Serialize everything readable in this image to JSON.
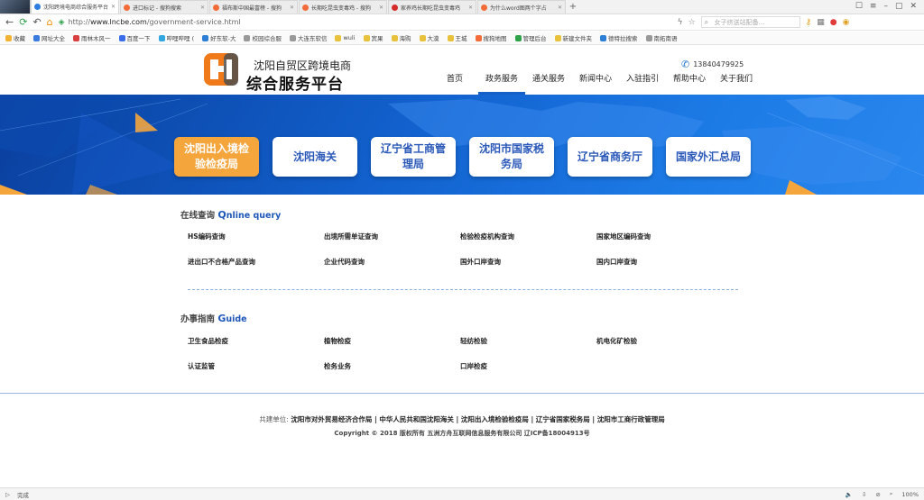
{
  "browser": {
    "tabs": [
      {
        "title": "沈阳跨境电商综合服务平台",
        "color": "#2f7de1",
        "active": true
      },
      {
        "title": "进口标记 - 搜狗搜索",
        "color": "#f26b38",
        "active": false
      },
      {
        "title": "福布斯中国最富榜 - 搜狗",
        "color": "#f26b38",
        "active": false
      },
      {
        "title": "长期吃昆虫变毒鸡 - 搜狗",
        "color": "#f26b38",
        "active": false
      },
      {
        "title": "家养鸡长期吃昆虫变毒鸡",
        "color": "#d62b2b",
        "active": false
      },
      {
        "title": "为什么word图两个字占",
        "color": "#f26b38",
        "active": false
      }
    ],
    "url_prefix": "http://",
    "url_domain": "www.lncbe.com",
    "url_path": "/government-service.html",
    "search_placeholder": "女子挤送站配备…",
    "bookmarks": [
      {
        "label": "收藏",
        "color": "#f2b233"
      },
      {
        "label": "网址大全",
        "color": "#3a7be0"
      },
      {
        "label": "雨林木风一",
        "color": "#d84040"
      },
      {
        "label": "百度一下",
        "color": "#3a6ee8"
      },
      {
        "label": "哔哩哔哩 (",
        "color": "#33a6e0"
      },
      {
        "label": "好东软-大",
        "color": "#2d7fd6"
      },
      {
        "label": "校园综合服",
        "color": "#999999"
      },
      {
        "label": "大连东软信",
        "color": "#999999"
      },
      {
        "label": "wuli",
        "color": "#e8c23c"
      },
      {
        "label": "宾果",
        "color": "#e8c23c"
      },
      {
        "label": "海购",
        "color": "#e8c23c"
      },
      {
        "label": "大漠",
        "color": "#e8c23c"
      },
      {
        "label": "王城",
        "color": "#e8c23c"
      },
      {
        "label": "搜狗地图",
        "color": "#f26b38"
      },
      {
        "label": "管理后台",
        "color": "#2fa24a"
      },
      {
        "label": "新建文件夹",
        "color": "#e8c23c"
      },
      {
        "label": "德特拉搜索",
        "color": "#2d7fd6"
      },
      {
        "label": "南拓南语",
        "color": "#999999"
      }
    ],
    "status_left": "完成",
    "zoom": "100%"
  },
  "header": {
    "brand_line1": "沈阳自贸区跨境电商",
    "brand_line2": "综合服务平台",
    "phone": "13840479925",
    "nav": [
      {
        "label": "首页",
        "active": false
      },
      {
        "label": "政务服务",
        "active": true
      },
      {
        "label": "通关服务",
        "active": false
      },
      {
        "label": "新闻中心",
        "active": false
      },
      {
        "label": "入驻指引",
        "active": false
      },
      {
        "label": "帮助中心",
        "active": false
      },
      {
        "label": "关于我们",
        "active": false
      }
    ]
  },
  "agencies": [
    {
      "label": "沈阳出入境检验检疫局",
      "active": true
    },
    {
      "label": "沈阳海关",
      "active": false
    },
    {
      "label": "辽宁省工商管理局",
      "active": false
    },
    {
      "label": "沈阳市国家税务局",
      "active": false
    },
    {
      "label": "辽宁省商务厅",
      "active": false
    },
    {
      "label": "国家外汇总局",
      "active": false
    }
  ],
  "online_query": {
    "title_cn": "在线查询",
    "title_en_first": "Q",
    "title_en_rest": "nline query",
    "links": [
      "HS编码查询",
      "出境所需单证查询",
      "检验检疫机构查询",
      "国家地区编码查询",
      "进出口不合格产品查询",
      "企业代码查询",
      "国外口岸查询",
      "国内口岸查询"
    ]
  },
  "guide": {
    "title_cn": "办事指南",
    "title_en_first": "G",
    "title_en_rest": "uide",
    "links": [
      "卫生食品检疫",
      "植物检疫",
      "轻纺检验",
      "机电化矿检验",
      "认证监管",
      "检务业务",
      "口岸检疫"
    ]
  },
  "footer": {
    "label": "共建单位:",
    "orgs": "沈阳市对外贸易经济合作局 | 中华人民共和国沈阳海关 | 沈阳出入境检验检疫局 | 辽宁省国家税务局 | 沈阳市工商行政管理局",
    "copyright": "Copyright © 2018 版权所有 五洲方舟互联网信息服务有限公司 辽ICP备18004913号"
  }
}
